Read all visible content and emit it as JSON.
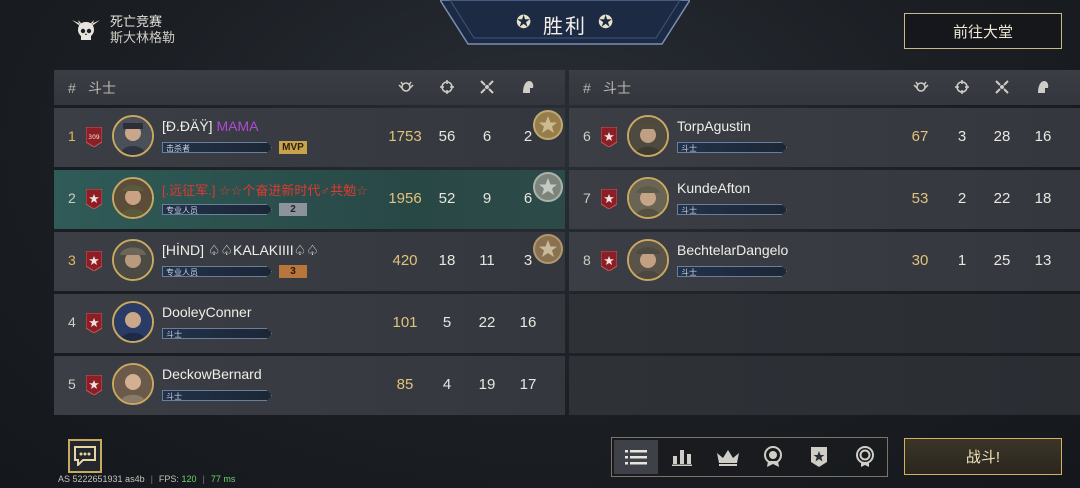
{
  "header": {
    "mode": "死亡竞赛",
    "map": "斯大林格勒",
    "result": "胜利",
    "lobby_button": "前往大堂"
  },
  "table_headers": {
    "hash": "#",
    "fighter": "斗士"
  },
  "team_left": [
    {
      "rank": "1",
      "name": "[Đ.ĐÄŸ]",
      "name_suffix": "MAMA",
      "tag": "击杀者",
      "level": "MVP",
      "score": "1753",
      "kills": "56",
      "assists": "6",
      "deaths": "2",
      "level_style": "mvp",
      "badge": "309"
    },
    {
      "rank": "2",
      "name": "[.远征军.] ☆☆个奋进新时代♂共勉☆",
      "name_suffix": "",
      "tag": "专业人员",
      "level": "2",
      "score": "1956",
      "kills": "52",
      "assists": "9",
      "deaths": "6",
      "level_style": "silver",
      "badge": ""
    },
    {
      "rank": "3",
      "name": "[HİND] ♤♤KALAKIIII♤♤",
      "name_suffix": "",
      "tag": "专业人员",
      "level": "3",
      "score": "420",
      "kills": "18",
      "assists": "11",
      "deaths": "3",
      "level_style": "bronze",
      "badge": ""
    },
    {
      "rank": "4",
      "name": "DooleyConner",
      "name_suffix": "",
      "tag": "斗士",
      "level": "",
      "score": "101",
      "kills": "5",
      "assists": "22",
      "deaths": "16",
      "level_style": "",
      "badge": ""
    },
    {
      "rank": "5",
      "name": "DeckowBernard",
      "name_suffix": "",
      "tag": "斗士",
      "level": "",
      "score": "85",
      "kills": "4",
      "assists": "19",
      "deaths": "17",
      "level_style": "",
      "badge": ""
    }
  ],
  "team_right": [
    {
      "rank": "6",
      "name": "TorpAgustin",
      "tag": "斗士",
      "score": "67",
      "kills": "3",
      "assists": "28",
      "deaths": "16"
    },
    {
      "rank": "7",
      "name": "KundeAfton",
      "tag": "斗士",
      "score": "53",
      "kills": "2",
      "assists": "22",
      "deaths": "18"
    },
    {
      "rank": "8",
      "name": "BechtelarDangelo",
      "tag": "斗士",
      "score": "30",
      "kills": "1",
      "assists": "25",
      "deaths": "13"
    }
  ],
  "footer": {
    "build": "AS 5222651931 as4b",
    "fps_label": "FPS:",
    "fps": "120",
    "ping": "77 ms"
  },
  "fight_button": "战斗!",
  "colors": {
    "gold": "#c9a85f",
    "highlight_row": "#2f5b58",
    "score": "#e1c27a"
  }
}
